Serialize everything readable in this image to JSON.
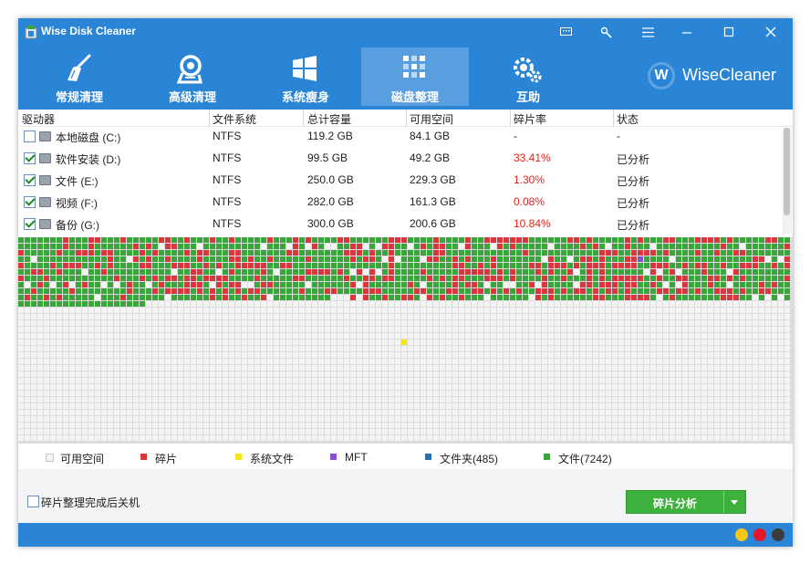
{
  "app": {
    "title": "Wise Disk Cleaner"
  },
  "nav": {
    "tabs": [
      {
        "label": "常规清理",
        "icon": "broom-icon"
      },
      {
        "label": "高级清理",
        "icon": "advanced-clean-icon"
      },
      {
        "label": "系统瘦身",
        "icon": "windows-icon"
      },
      {
        "label": "磁盘整理",
        "icon": "defrag-icon",
        "active": true
      },
      {
        "label": "互助",
        "icon": "gears-icon"
      }
    ],
    "brand": {
      "logo_letter": "W",
      "name": "WiseCleaner"
    }
  },
  "table": {
    "headers": [
      "驱动器",
      "文件系统",
      "总计容量",
      "可用空间",
      "碎片率",
      "状态"
    ],
    "rows": [
      {
        "checked": false,
        "name": "本地磁盘 (C:)",
        "fs": "NTFS",
        "total": "119.2 GB",
        "free": "84.1 GB",
        "frag": "-",
        "status": "-"
      },
      {
        "checked": true,
        "name": "软件安装 (D:)",
        "fs": "NTFS",
        "total": "99.5 GB",
        "free": "49.2 GB",
        "frag": "33.41%",
        "status": "已分析"
      },
      {
        "checked": true,
        "name": "文件 (E:)",
        "fs": "NTFS",
        "total": "250.0 GB",
        "free": "229.3 GB",
        "frag": "1.30%",
        "status": "已分析"
      },
      {
        "checked": true,
        "name": "视频 (F:)",
        "fs": "NTFS",
        "total": "282.0 GB",
        "free": "161.3 GB",
        "frag": "0.08%",
        "status": "已分析"
      },
      {
        "checked": true,
        "name": "备份 (G:)",
        "fs": "NTFS",
        "total": "300.0 GB",
        "free": "200.6 GB",
        "frag": "10.84%",
        "status": "已分析"
      }
    ]
  },
  "cluster_map": {
    "colors": {
      "free": "#f4f4f4",
      "fragment": "#d9373e",
      "system": "#f7e51a",
      "mft": "#8a4fd0",
      "folder": "#2f6db3",
      "file": "#3aa53a"
    }
  },
  "legend": [
    {
      "label": "可用空间",
      "color": "#f4f4f4"
    },
    {
      "label": "碎片",
      "color": "#d9373e"
    },
    {
      "label": "系统文件",
      "color": "#f7e51a"
    },
    {
      "label": "MFT",
      "color": "#8a4fd0"
    },
    {
      "label": "文件夹(485)",
      "color": "#2f6db3"
    },
    {
      "label": "文件(7242)",
      "color": "#3aa53a"
    }
  ],
  "options": {
    "shutdown_label": "碎片整理完成后关机",
    "shutdown_checked": false
  },
  "actions": {
    "analyze_label": "碎片分析"
  },
  "colors": {
    "accent": "#2b85d6",
    "analyze_button": "#3eb13c",
    "fragment_text": "#e0231c"
  }
}
